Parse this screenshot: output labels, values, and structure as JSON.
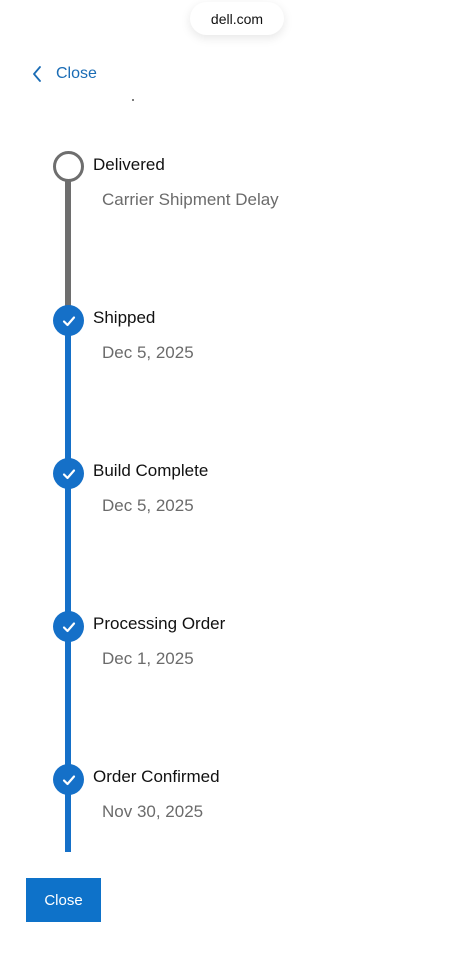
{
  "browser": {
    "url": "dell.com"
  },
  "header": {
    "close_label": "Close"
  },
  "timeline": {
    "steps": [
      {
        "title": "Delivered",
        "subtitle": "Carrier Shipment Delay",
        "status": "pending"
      },
      {
        "title": "Shipped",
        "subtitle": "Dec 5, 2025",
        "status": "complete"
      },
      {
        "title": "Build Complete",
        "subtitle": "Dec 5, 2025",
        "status": "complete"
      },
      {
        "title": "Processing Order",
        "subtitle": "Dec 1, 2025",
        "status": "complete"
      },
      {
        "title": "Order Confirmed",
        "subtitle": "Nov 30, 2025",
        "status": "complete"
      }
    ]
  },
  "footer": {
    "close_button_label": "Close"
  },
  "colors": {
    "accent": "#1570c8",
    "link": "#1a6cb5",
    "pending_line": "#6e6e6e",
    "subtitle_text": "#6b6b6b"
  }
}
